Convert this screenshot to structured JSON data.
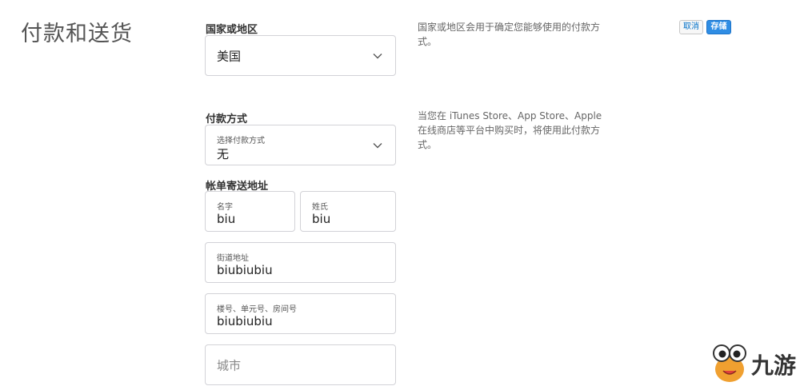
{
  "page": {
    "title": "付款和送货"
  },
  "actions": {
    "cancel_label": "取消",
    "save_label": "存储"
  },
  "country": {
    "section_label": "国家或地区",
    "value": "美国",
    "help": "国家或地区会用于确定您能够使用的付款方式。"
  },
  "payment": {
    "section_label": "付款方式",
    "field_label": "选择付款方式",
    "value": "无",
    "help": "当您在 iTunes Store、App Store、Apple 在线商店等平台中购买时，将使用此付款方式。"
  },
  "billing": {
    "section_label": "帐单寄送地址",
    "first_name": {
      "label": "名字",
      "value": "biu"
    },
    "last_name": {
      "label": "姓氏",
      "value": "biu"
    },
    "street": {
      "label": "街道地址",
      "value": "biubiubiu"
    },
    "unit": {
      "label": "楼号、单元号、房间号",
      "value": "biubiubiu"
    },
    "city": {
      "placeholder": "城市"
    }
  },
  "watermark": {
    "text": "九游",
    "icon": "mascot-icon"
  },
  "colors": {
    "accent": "#2f8de4",
    "border": "#d2d2d7",
    "text": "#333333",
    "muted": "#666666"
  }
}
